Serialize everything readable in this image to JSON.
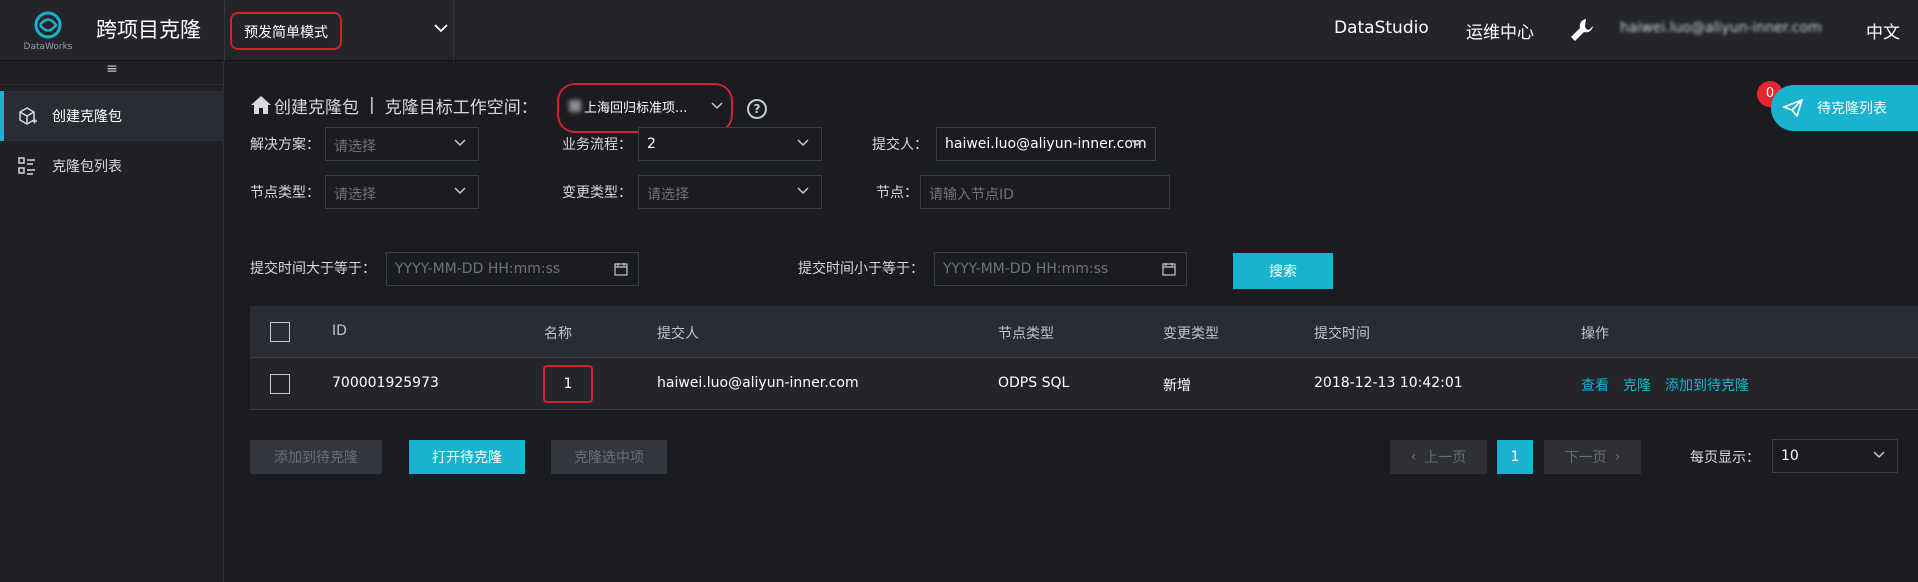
{
  "header": {
    "logo_text": "DataWorks",
    "app_title": "跨项目克隆",
    "mode": "预发简单模式",
    "nav": [
      "DataStudio",
      "运维中心"
    ],
    "user": "haiwei.luo@aliyun-inner.com",
    "lang": "中文"
  },
  "sidebar": {
    "collapse_icon": "menu-icon",
    "items": [
      {
        "label": "创建克隆包",
        "icon": "package-add-icon"
      },
      {
        "label": "克隆包列表",
        "icon": "list-icon"
      }
    ]
  },
  "crumb": {
    "title": "创建克隆包",
    "separator": "|",
    "ws_label": "克隆目标工作空间：",
    "ws_value": "上海回归标准项...",
    "help": "?"
  },
  "pending": {
    "label": "待克隆列表",
    "count": "0"
  },
  "filters": {
    "solution_label": "解决方案：",
    "solution_placeholder": "请选择",
    "flow_label": "业务流程：",
    "flow_value": "2",
    "submitter_label": "提交人：",
    "submitter_value": "haiwei.luo@aliyun-inner.com",
    "nodetype_label": "节点类型：",
    "nodetype_placeholder": "请选择",
    "changetype_label": "变更类型：",
    "changetype_placeholder": "请选择",
    "node_label": "节点：",
    "node_placeholder": "请输入节点ID",
    "time_from_label": "提交时间大于等于：",
    "time_from_placeholder": "YYYY-MM-DD HH:mm:ss",
    "time_to_label": "提交时间小于等于：",
    "time_to_placeholder": "YYYY-MM-DD HH:mm:ss",
    "search": "搜索"
  },
  "table": {
    "headers": [
      "ID",
      "名称",
      "提交人",
      "节点类型",
      "变更类型",
      "提交时间",
      "操作"
    ],
    "rows": [
      {
        "id": "700001925973",
        "name": "1",
        "submitter": "haiwei.luo@aliyun-inner.com",
        "node_type": "ODPS SQL",
        "change_type": "新增",
        "time": "2018-12-13 10:42:01",
        "actions": [
          "查看",
          "克隆",
          "添加到待克隆"
        ]
      }
    ]
  },
  "footer": {
    "add_pending": "添加到待克隆",
    "open_pending": "打开待克隆",
    "clone_selected": "克隆选中项",
    "prev": "上一页",
    "page": "1",
    "next": "下一页",
    "per_page_label": "每页显示：",
    "per_page_value": "10"
  },
  "colors": {
    "accent": "#1ab3cf",
    "highlight": "#d0222f",
    "badge": "#e5262f"
  }
}
